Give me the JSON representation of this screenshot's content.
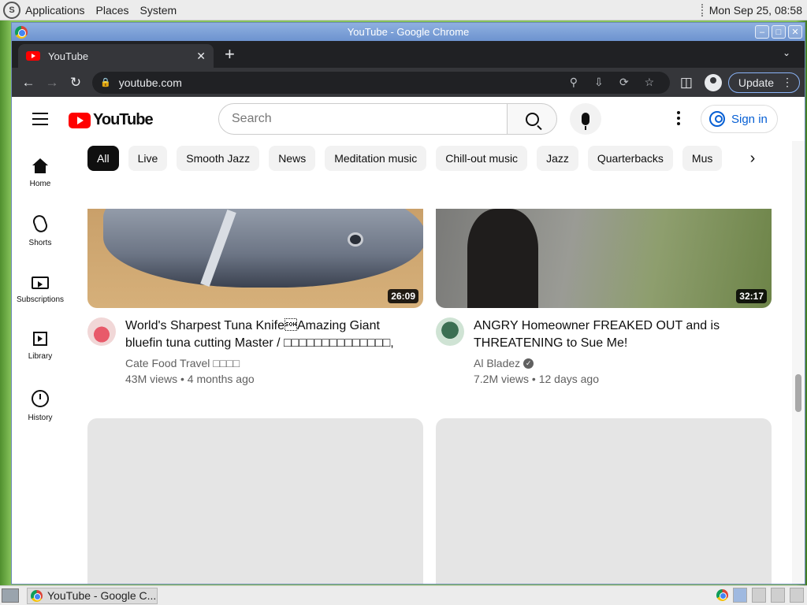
{
  "top_panel": {
    "menus": [
      "Applications",
      "Places",
      "System"
    ],
    "clock": "Mon Sep 25, 08:58"
  },
  "window": {
    "title": "YouTube - Google Chrome"
  },
  "browser": {
    "tab_title": "YouTube",
    "url": "youtube.com",
    "update_label": "Update"
  },
  "youtube": {
    "logo_text": "YouTube",
    "search_placeholder": "Search",
    "signin_label": "Sign in",
    "chips": [
      "All",
      "Live",
      "Smooth Jazz",
      "News",
      "Meditation music",
      "Chill-out music",
      "Jazz",
      "Quarterbacks",
      "Mus"
    ],
    "guide": [
      {
        "label": "Home",
        "icon": "home-icon"
      },
      {
        "label": "Shorts",
        "icon": "shorts-icon"
      },
      {
        "label": "Subscriptions",
        "icon": "subscriptions-icon"
      },
      {
        "label": "Library",
        "icon": "library-icon"
      },
      {
        "label": "History",
        "icon": "history-icon"
      }
    ],
    "videos": [
      {
        "title": "World's Sharpest Tuna Knife\u0001Amazing Giant bluefin tuna cutting Master / □□□□□□□□□□□□□□, □□□□□…",
        "channel": "Cate Food Travel □□□□",
        "stats": "43M views • 4 months ago",
        "duration": "26:09",
        "verified": false
      },
      {
        "title": "ANGRY Homeowner FREAKED OUT and is THREATENING to Sue Me!",
        "channel": "Al Bladez",
        "stats": "7.2M views • 12 days ago",
        "duration": "32:17",
        "verified": true
      }
    ]
  },
  "taskbar": {
    "task_label": "YouTube - Google C..."
  }
}
